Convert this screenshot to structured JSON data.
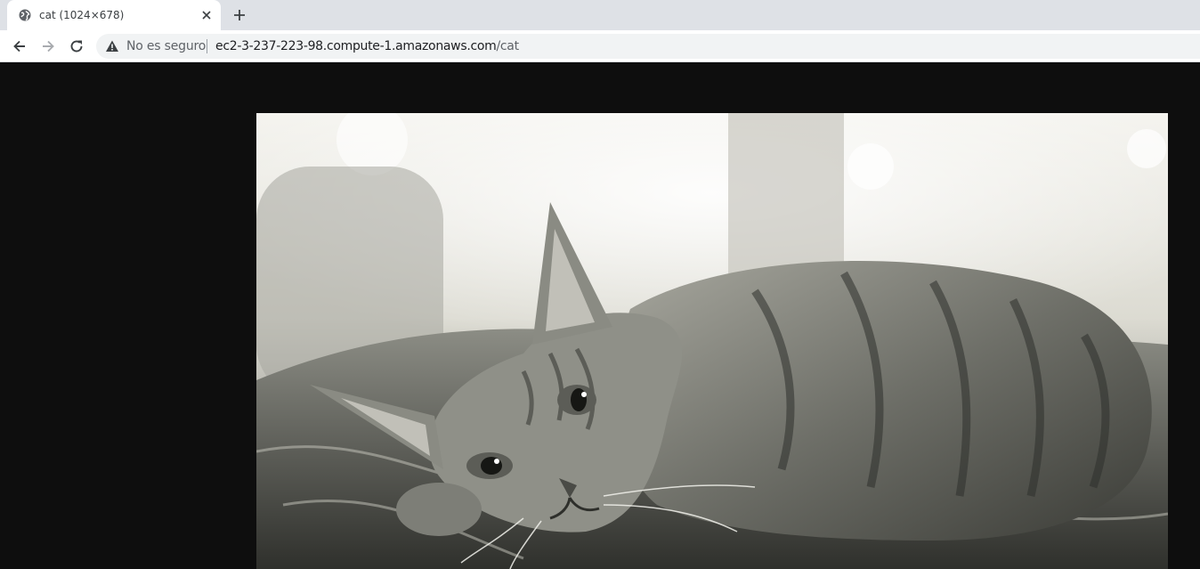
{
  "tab": {
    "title": "cat (1024×678)",
    "favicon": "globe-icon"
  },
  "toolbar": {
    "back": "arrow-left-icon",
    "forward": "arrow-right-icon",
    "reload": "reload-icon"
  },
  "omnibox": {
    "security_icon": "warning-triangle-icon",
    "security_text": "No es seguro",
    "url_host": "ec2-3-237-223-98.compute-1.amazonaws.com",
    "url_path": "/cat"
  },
  "content": {
    "image_alt": "cat",
    "background": "#0e0e0e"
  }
}
